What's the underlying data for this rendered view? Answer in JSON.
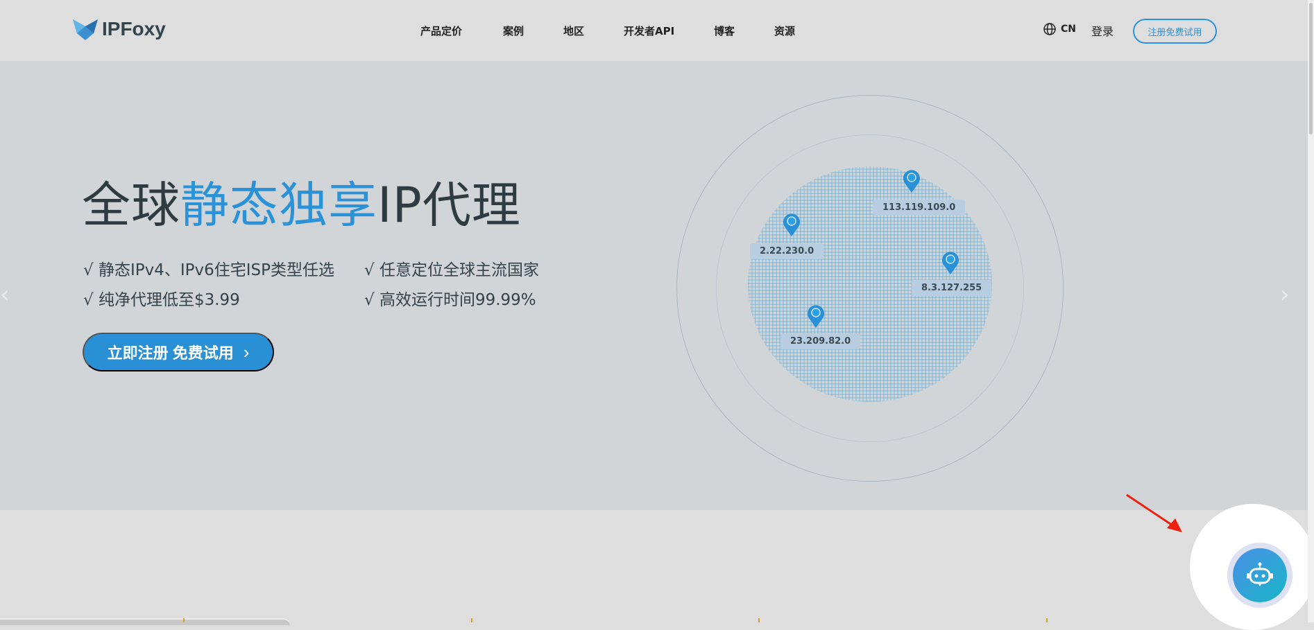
{
  "header": {
    "logo_text": "IPFoxy",
    "nav": [
      "产品定价",
      "案例",
      "地区",
      "开发者API",
      "博客",
      "资源"
    ],
    "lang": "CN",
    "login": "登录",
    "register": "注册免费试用"
  },
  "hero": {
    "title_pre": "全球",
    "title_highlight": "静态独享",
    "title_post": "IP代理",
    "bullets": [
      "√ 静态IPv4、IPv6住宅ISP类型任选",
      "√ 任意定位全球主流国家",
      "√ 纯净代理低至$3.99",
      "√ 高效运行时间99.99%"
    ],
    "cta": "立即注册 免费试用",
    "ip_labels": [
      "113.119.109.0",
      "2.22.230.0",
      "8.3.127.255",
      "23.209.82.0"
    ]
  },
  "colors": {
    "accent": "#2a90d6",
    "hero_bg": "#d1d5d8",
    "page_bg": "#dedede"
  }
}
